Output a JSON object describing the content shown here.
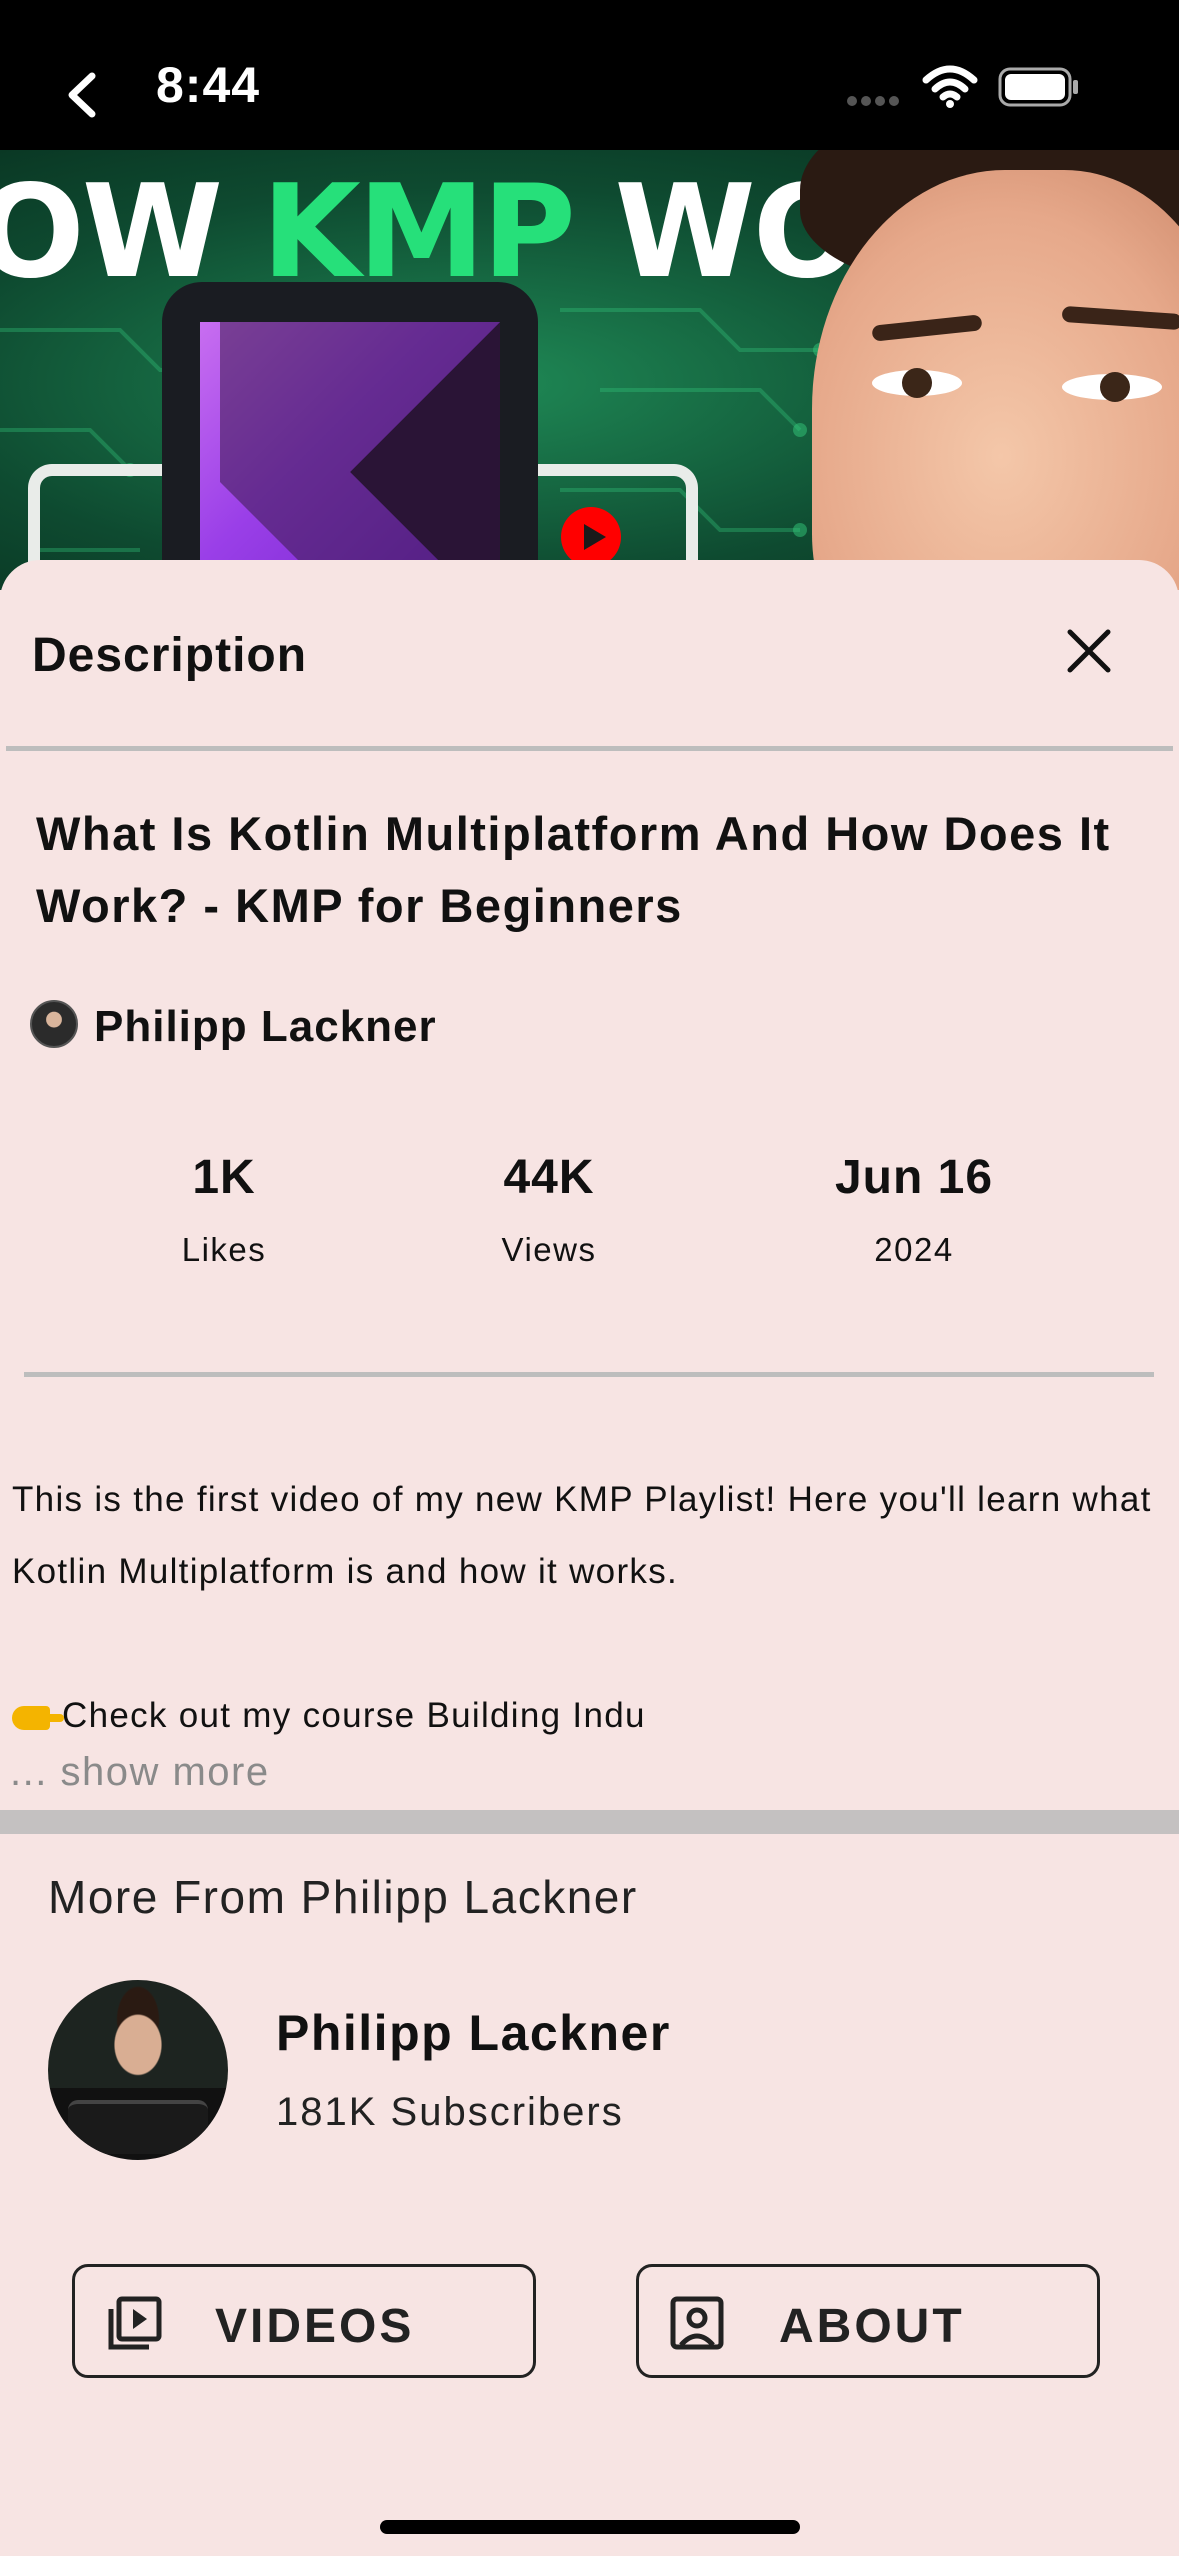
{
  "status_bar": {
    "time": "8:44"
  },
  "thumbnail": {
    "title_prefix": "OW ",
    "title_accent": "KMP",
    "title_suffix": " WORKS"
  },
  "sheet": {
    "title": "Description",
    "video_title": "What Is Kotlin Multiplatform And How Does It Work? - KMP for Beginners",
    "channel_name": "Philipp Lackner",
    "stats": [
      {
        "value": "1K",
        "label": "Likes"
      },
      {
        "value": "44K",
        "label": "Views"
      },
      {
        "value": "Jun 16",
        "label": "2024"
      }
    ],
    "description": {
      "line1": "This is the first video of my new KMP Playlist! Here you'll learn what Kotlin Multiplatform is and how it works.",
      "line2": "Check out my course Building Indu",
      "show_more": "... show more"
    },
    "more_from": {
      "heading": "More From Philipp Lackner",
      "channel_name": "Philipp Lackner",
      "subscribers": "181K Subscribers",
      "videos_button": "VIDEOS",
      "about_button": "ABOUT"
    }
  },
  "colors": {
    "background": "#f7e4e3",
    "accent_green": "#26e07a",
    "play_red": "#ff0000"
  }
}
